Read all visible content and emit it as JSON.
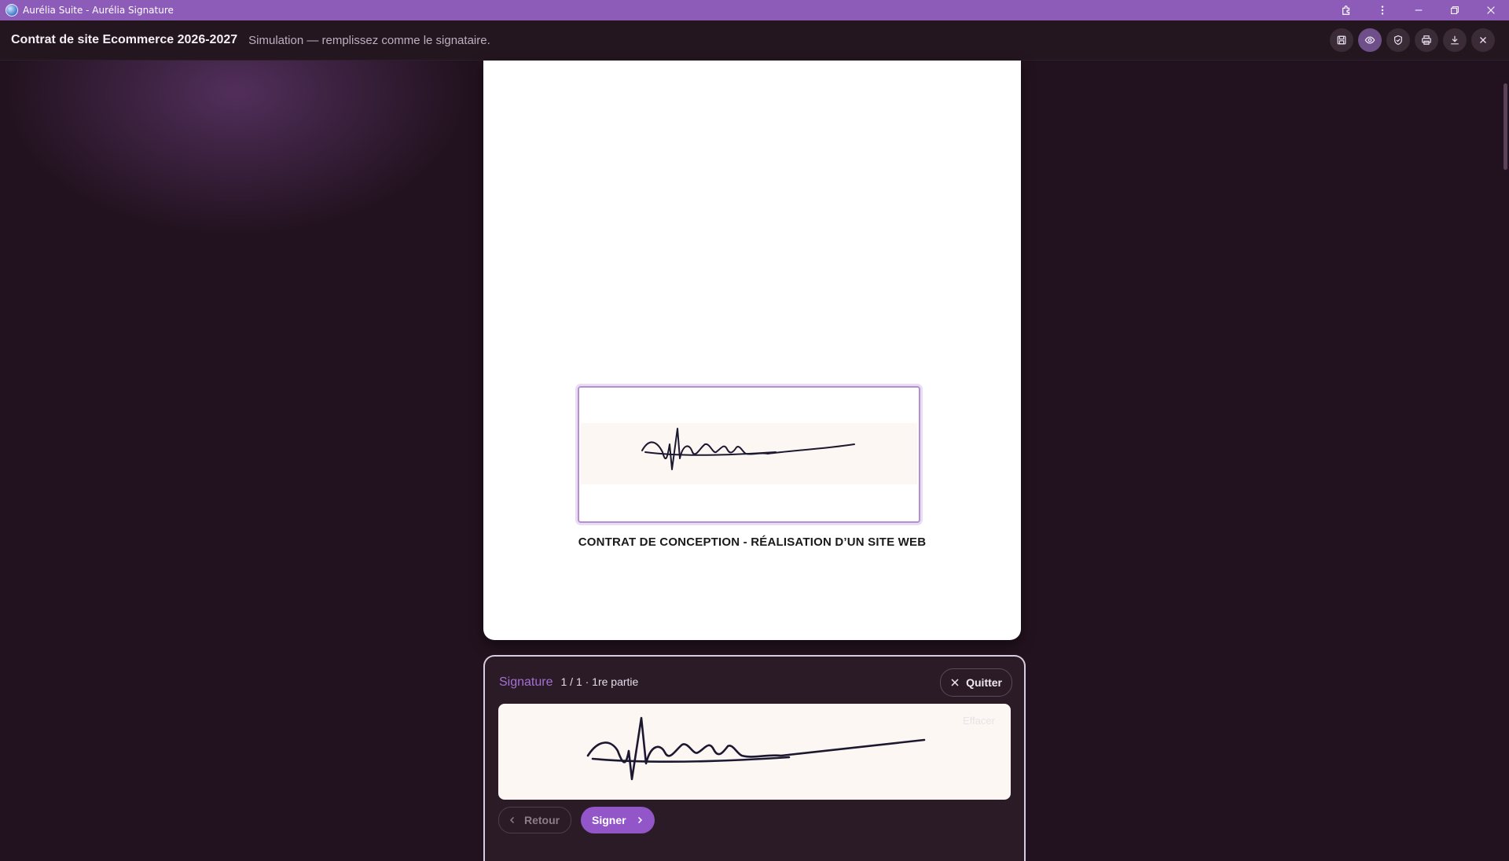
{
  "window": {
    "title": "Aurélia Suite - Aurélia Signature",
    "controls": [
      "puzzle-icon",
      "more-vertical-icon",
      "minimize-icon",
      "restore-icon",
      "close-icon"
    ]
  },
  "header": {
    "document_title": "Contrat de site Ecommerce 2026-2027",
    "subtitle": "Simulation — remplissez comme le signataire.",
    "toolbar": [
      "save-icon",
      "eye-icon",
      "shield-icon",
      "print-icon",
      "download-icon",
      "close-icon"
    ]
  },
  "document": {
    "contract_title": "CONTRAT DE CONCEPTION - RÉALISATION D’UN SITE WEB"
  },
  "signature_panel": {
    "label": "Signature",
    "step": "1 / 1 · 1re partie",
    "quit_label": "Quitter",
    "clear_label": "Effacer",
    "back_label": "Retour",
    "sign_label": "Signer"
  },
  "colors": {
    "titlebar": "#8d5bb8",
    "accent": "#9256c8",
    "background": "#22121f"
  }
}
